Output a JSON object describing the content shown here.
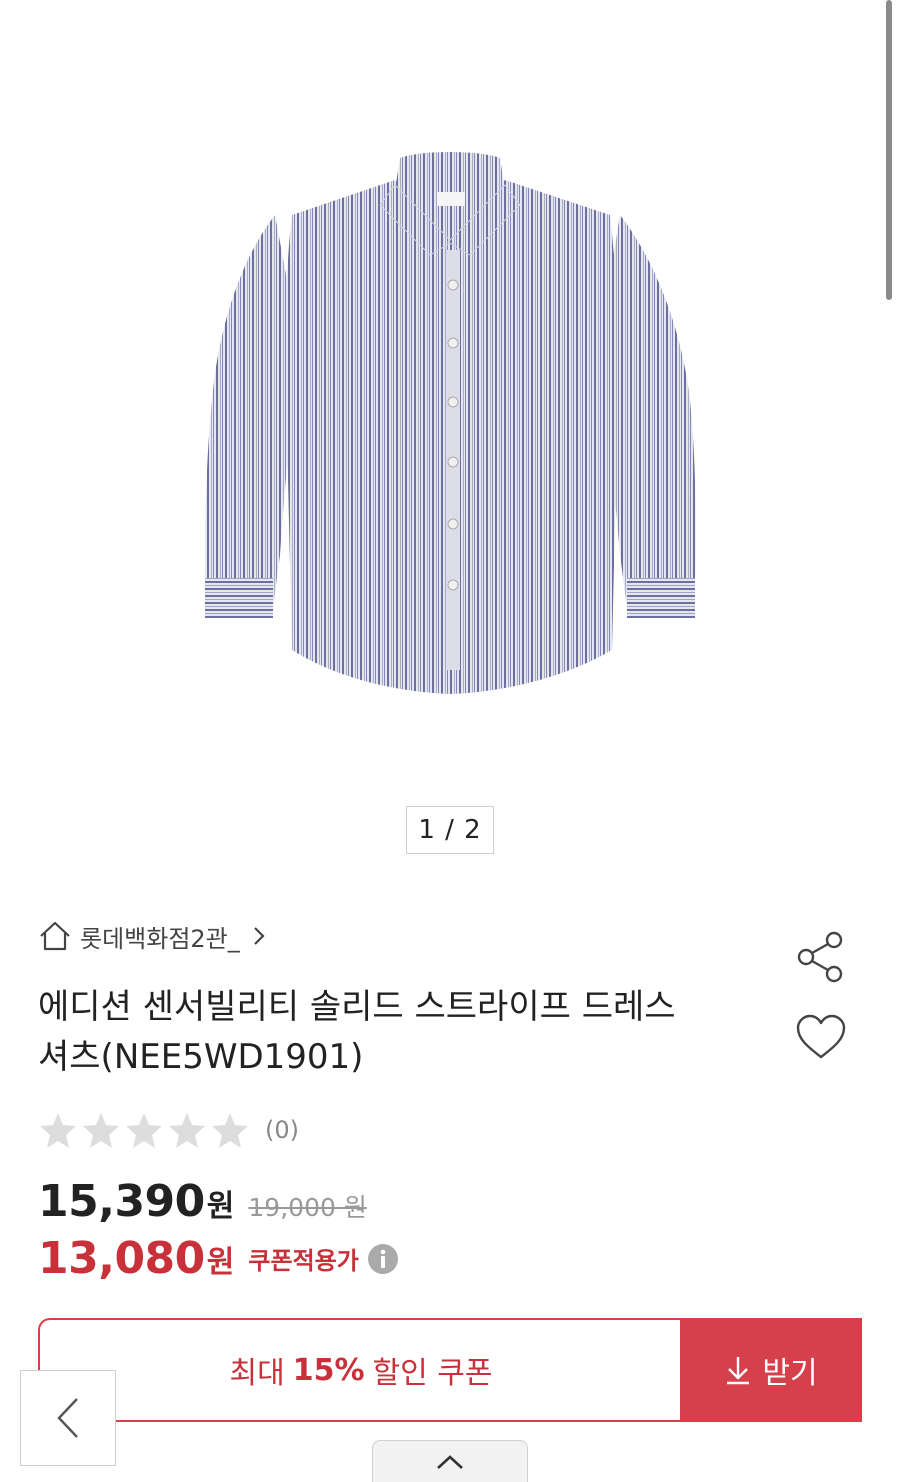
{
  "gallery": {
    "image_alt": "striped dress shirt",
    "pager": "1 / 2"
  },
  "store": {
    "name": "롯데백화점2관_"
  },
  "product": {
    "title_line1": "에디션 센서빌리티 솔리드 스트라이프 드레스",
    "title_line2": "셔츠(NEE5WD1901)"
  },
  "rating": {
    "stars": 0,
    "max": 5,
    "count": "(0)"
  },
  "price": {
    "sale": "15,390",
    "sale_unit": "원",
    "original": "19,000 원",
    "coupon": "13,080",
    "coupon_unit": "원",
    "coupon_label": "쿠폰적용가"
  },
  "coupon": {
    "prefix": "최대",
    "percent": "15%",
    "suffix": "할인 쿠폰",
    "receive_label": "받기"
  },
  "colors": {
    "accent": "#d6404a",
    "price_red": "#c8303a",
    "star_empty": "#dddddd"
  },
  "icons": {
    "home": "home-icon",
    "chevron": "chevron-right-icon",
    "share": "share-icon",
    "heart": "heart-icon",
    "info": "info-icon",
    "download": "download-icon",
    "back": "chevron-left-icon",
    "up": "chevron-up-icon"
  }
}
